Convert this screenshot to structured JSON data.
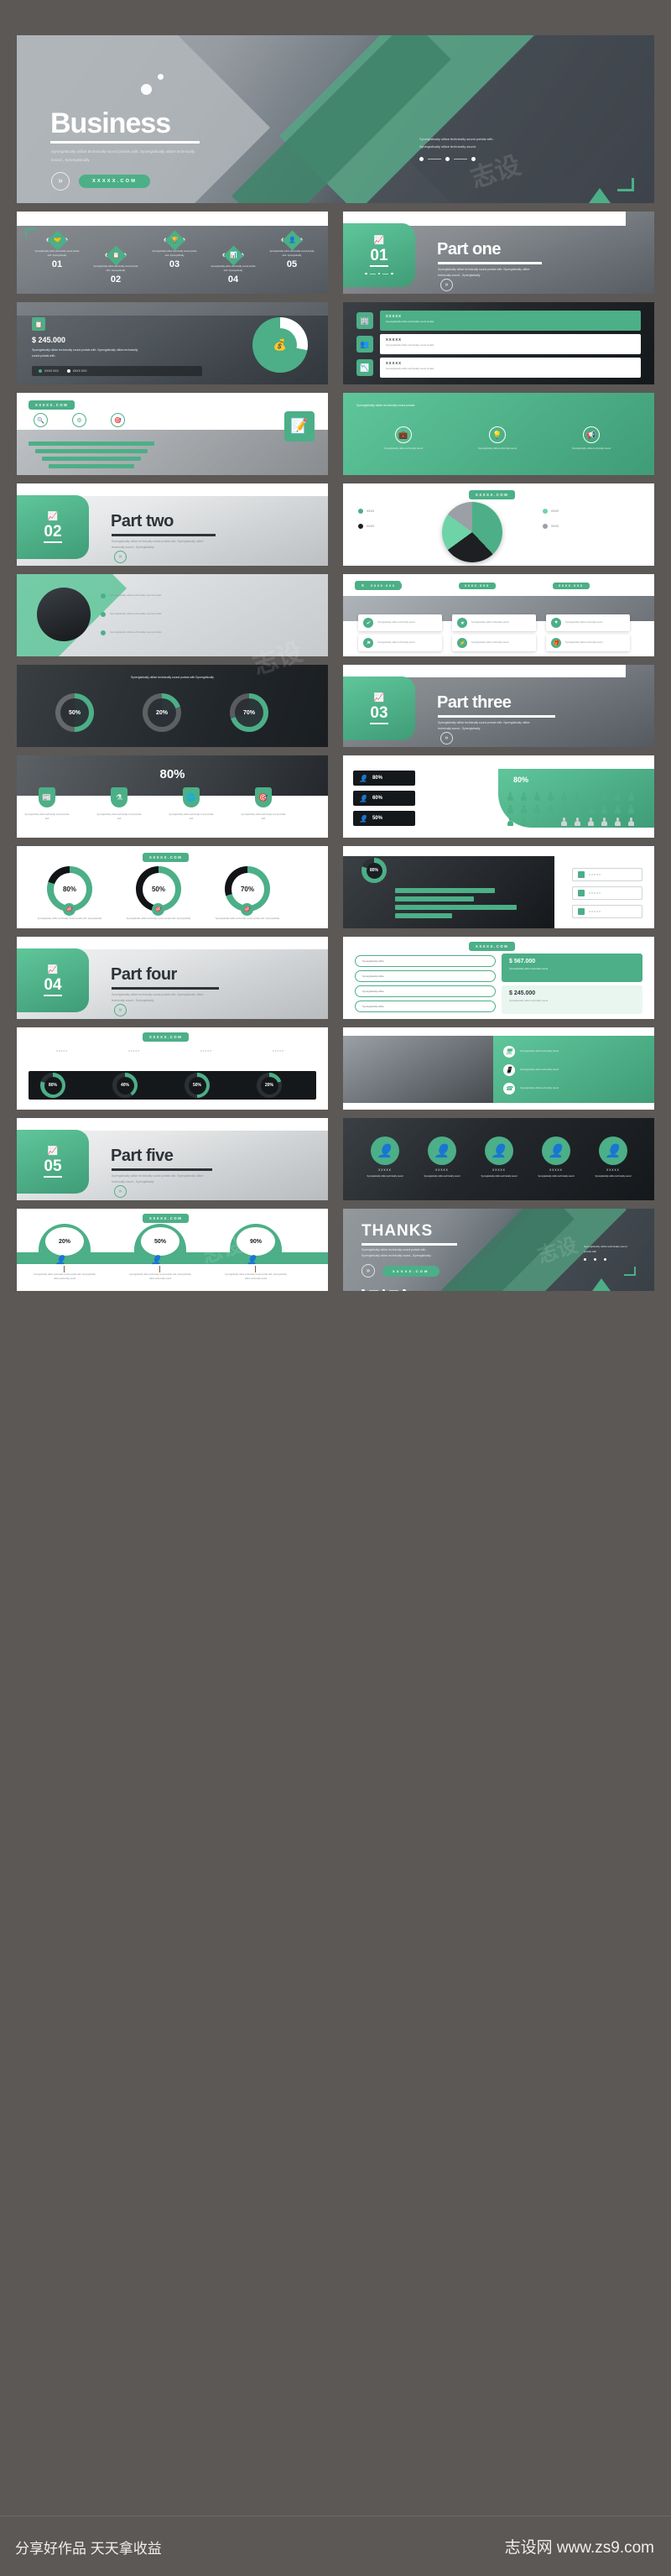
{
  "meta": {
    "brand_green": "#4caf87",
    "brand_green_light": "#5fc69a",
    "bg": "#5b5856"
  },
  "footer": {
    "left_text": "分享好作品 天天拿收益",
    "right_text": "志设网 www.zs9.com"
  },
  "watermark": "志设",
  "hero": {
    "title": "Business",
    "subtitle": "Synergistically utilize technically sound portals with. Synergistically utilize technically sound., Synergistically",
    "cta_icon": "double-chevron-right-icon",
    "cta_label": "XXXXX.COM",
    "right_text": "Synergistically utilize technically sound portals with. Synergistically utilize technically sound.",
    "dots": 3
  },
  "slides": [
    {
      "id": "process-5-step",
      "tag": "",
      "corner": "top-left",
      "items": [
        {
          "num": "01",
          "icon": "handshake-icon",
          "text": "Synergistically utilize technically sound portals with. Synergistically"
        },
        {
          "num": "02",
          "icon": "clipboard-icon",
          "text": "Synergistically utilize technically sound portals with. Synergistically"
        },
        {
          "num": "03",
          "icon": "trophy-icon",
          "text": "Synergistically utilize technically sound portals with. Synergistically"
        },
        {
          "num": "04",
          "icon": "bar-chart-icon",
          "text": "Synergistically utilize technically sound portals with. Synergistically"
        },
        {
          "num": "05",
          "icon": "user-icon",
          "text": "Synergistically utilize technically sound portals with. Synergistically"
        }
      ]
    },
    {
      "id": "part-one",
      "number": "01",
      "icon": "growth-chart-icon",
      "title": "Part one",
      "body": "Synergistically utilize technically sound portals with. Synergistically utilize technically sound., Synergistically",
      "cta_icon": "double-chevron-right-icon"
    },
    {
      "id": "revenue-donut",
      "badge_icon": "document-icon",
      "amount": "$ 245.000",
      "body": "Synergistically utilize technically sound portals with. Synergistically utilize technically sound portals with.",
      "legend": [
        {
          "label": "XXXX XXX",
          "color": "#4caf87"
        },
        {
          "label": "XXXX XXX",
          "color": "#ffffff"
        }
      ],
      "donut_center_icon": "coins-icon",
      "donut_values": [
        72,
        28
      ]
    },
    {
      "id": "three-row-cards",
      "rows": [
        {
          "icon": "building-icon",
          "title": "XXXXX",
          "text": "Synergistically utilize technically sound portals"
        },
        {
          "icon": "people-icon",
          "title": "XXXXX",
          "text": "Synergistically utilize technically sound portals"
        },
        {
          "icon": "chart-icon",
          "title": "XXXXX",
          "text": "Synergistically utilize technically sound portals"
        }
      ]
    },
    {
      "id": "timeline-bars",
      "tag": "XXXXX.COM",
      "icons": [
        "search-icon",
        "gear-icon",
        "target-icon"
      ],
      "panel_icon": "edit-icon",
      "bars": 4
    },
    {
      "id": "four-icon-overlay",
      "heading": "Synergistically utilize technically sound portals",
      "cards": [
        {
          "icon": "briefcase-icon",
          "text": "Synergistically utilize technically sound"
        },
        {
          "icon": "lightbulb-icon",
          "text": "Synergistically utilize technically sound"
        },
        {
          "icon": "megaphone-icon",
          "text": "Synergistically utilize technically sound"
        }
      ]
    },
    {
      "id": "part-two",
      "number": "02",
      "icon": "growth-chart-icon",
      "title": "Part two",
      "body": "Synergistically utilize technically sound portals with. Synergistically utilize technically sound., Synergistically",
      "cta_icon": "double-chevron-right-icon"
    },
    {
      "id": "pie-slide",
      "tag": "XXXXX.COM",
      "pie_slices": [
        {
          "label": "XXXX",
          "value": 38,
          "color": "#4caf87"
        },
        {
          "label": "XXXX",
          "value": 27,
          "color": "#1d1f22"
        },
        {
          "label": "XXXX",
          "value": 20,
          "color": "#6fd3a8"
        },
        {
          "label": "XXXX",
          "value": 15,
          "color": "#9aa0a5"
        }
      ]
    },
    {
      "id": "portrait-bullets",
      "bullets": [
        "Synergistically utilize technically sound portals",
        "Synergistically utilize technically sound portals",
        "Synergistically utilize technically sound portals"
      ]
    },
    {
      "id": "grid-cards",
      "tag": "XXXXX.COM",
      "columns": [
        "XXXX.XXX",
        "XXXX.XXX",
        "XXXX.XXX"
      ],
      "rows": 2,
      "icons": [
        "check-icon",
        "star-icon",
        "heart-icon",
        "flag-icon",
        "bolt-icon",
        "gift-icon"
      ]
    },
    {
      "id": "three-rings",
      "rings": [
        {
          "value": "50%",
          "pct": 50
        },
        {
          "value": "20%",
          "pct": 20
        },
        {
          "value": "70%",
          "pct": 70
        }
      ],
      "heading": "Synergistically utilize technically sound portals with Synergistically"
    },
    {
      "id": "part-three",
      "number": "03",
      "icon": "growth-chart-icon",
      "title": "Part three",
      "body": "Synergistically utilize technically sound portals with. Synergistically utilize technically sound., Synergistically",
      "cta_icon": "double-chevron-right-icon"
    },
    {
      "id": "laptop-80",
      "big_value": "80%",
      "shields": [
        {
          "icon": "news-icon",
          "text": "Synergistically utilize technically sound portals with"
        },
        {
          "icon": "science-icon",
          "text": "Synergistically utilize technically sound portals with"
        },
        {
          "icon": "network-icon",
          "text": "Synergistically utilize technically sound portals with"
        },
        {
          "icon": "target-icon",
          "text": "Synergistically utilize technically sound portals with"
        }
      ]
    },
    {
      "id": "people-pictogram",
      "big_value": "80%",
      "stats": [
        {
          "value": "80%",
          "icon": "user-icon"
        },
        {
          "value": "60%",
          "icon": "user-icon"
        },
        {
          "value": "50%",
          "icon": "user-icon"
        }
      ],
      "people_total": 30,
      "people_filled": 24
    },
    {
      "id": "three-donuts",
      "tag": "XXXXX.COM",
      "donuts": [
        {
          "value": "80%",
          "pct": 80
        },
        {
          "value": "50%",
          "pct": 50
        },
        {
          "value": "70%",
          "pct": 70
        }
      ],
      "caption": "Synergistically utilize technically sound portals with. Synergistically"
    },
    {
      "id": "dark-bars",
      "big_value": "80%",
      "bars": [
        70,
        55,
        85,
        40
      ],
      "side_items": [
        "XXXXX",
        "XXXXX",
        "XXXXX"
      ]
    },
    {
      "id": "part-four",
      "number": "04",
      "icon": "growth-chart-icon",
      "title": "Part four",
      "body": "Synergistically utilize technically sound portals with. Synergistically utilize technically sound., Synergistically",
      "cta_icon": "double-chevron-right-icon"
    },
    {
      "id": "price-panels",
      "tag": "XXXXX.COM",
      "pills": [
        "Synergistically utilize",
        "Synergistically utilize",
        "Synergistically utilize",
        "Synergistically utilize"
      ],
      "amounts": [
        {
          "value": "$ 567.000",
          "caption": "Synergistically utilize technically sound"
        },
        {
          "value": "$ 245.000",
          "caption": "Synergistically utilize technically sound"
        }
      ]
    },
    {
      "id": "dark-progress",
      "tag": "XXXXX.COM",
      "circles": [
        {
          "value": "80%",
          "pct": 80
        },
        {
          "value": "40%",
          "pct": 40
        },
        {
          "value": "50%",
          "pct": 50
        },
        {
          "value": "20%",
          "pct": 20
        }
      ],
      "columns": [
        "XXXXX",
        "XXXXX",
        "XXXXX",
        "XXXXX"
      ]
    },
    {
      "id": "device-mockup",
      "items": [
        {
          "icon": "monitor-icon",
          "text": "Synergistically utilize technically sound"
        },
        {
          "icon": "tablet-icon",
          "text": "Synergistically utilize technically sound"
        },
        {
          "icon": "phone-icon",
          "text": "Synergistically utilize technically sound"
        }
      ]
    },
    {
      "id": "part-five",
      "number": "05",
      "icon": "growth-chart-icon",
      "title": "Part five",
      "body": "Synergistically utilize technically sound portals with. Synergistically utilize technically sound., Synergistically",
      "cta_icon": "double-chevron-right-icon"
    },
    {
      "id": "team-circles",
      "members": [
        {
          "icon": "user-icon",
          "name": "XXXXX"
        },
        {
          "icon": "user-icon",
          "name": "XXXXX"
        },
        {
          "icon": "user-icon",
          "name": "XXXXX"
        },
        {
          "icon": "user-icon",
          "name": "XXXXX"
        },
        {
          "icon": "user-icon",
          "name": "XXXXX"
        }
      ]
    },
    {
      "id": "funnel-percent",
      "tag": "XXXXX.COM",
      "items": [
        {
          "value": "20%",
          "icon": "user-icon",
          "text": "Synergistically utilize technically sound portals with. Synergistically utilize technically sound"
        },
        {
          "value": "50%",
          "icon": "user-icon",
          "text": "Synergistically utilize technically sound portals with. Synergistically utilize technically sound"
        },
        {
          "value": "90%",
          "icon": "user-icon",
          "text": "Synergistically utilize technically sound portals with. Synergistically utilize technically sound"
        }
      ]
    },
    {
      "id": "thanks",
      "title": "THANKS",
      "body": "Synergistically utilize technically sound portals with. Synergistically utilize technically sound., Synergistically",
      "cta_icon": "double-chevron-right-icon",
      "cta_label": "XXXXX.COM",
      "right_text": "Synergistically utilize technically sound portals with",
      "dots": 3
    }
  ]
}
